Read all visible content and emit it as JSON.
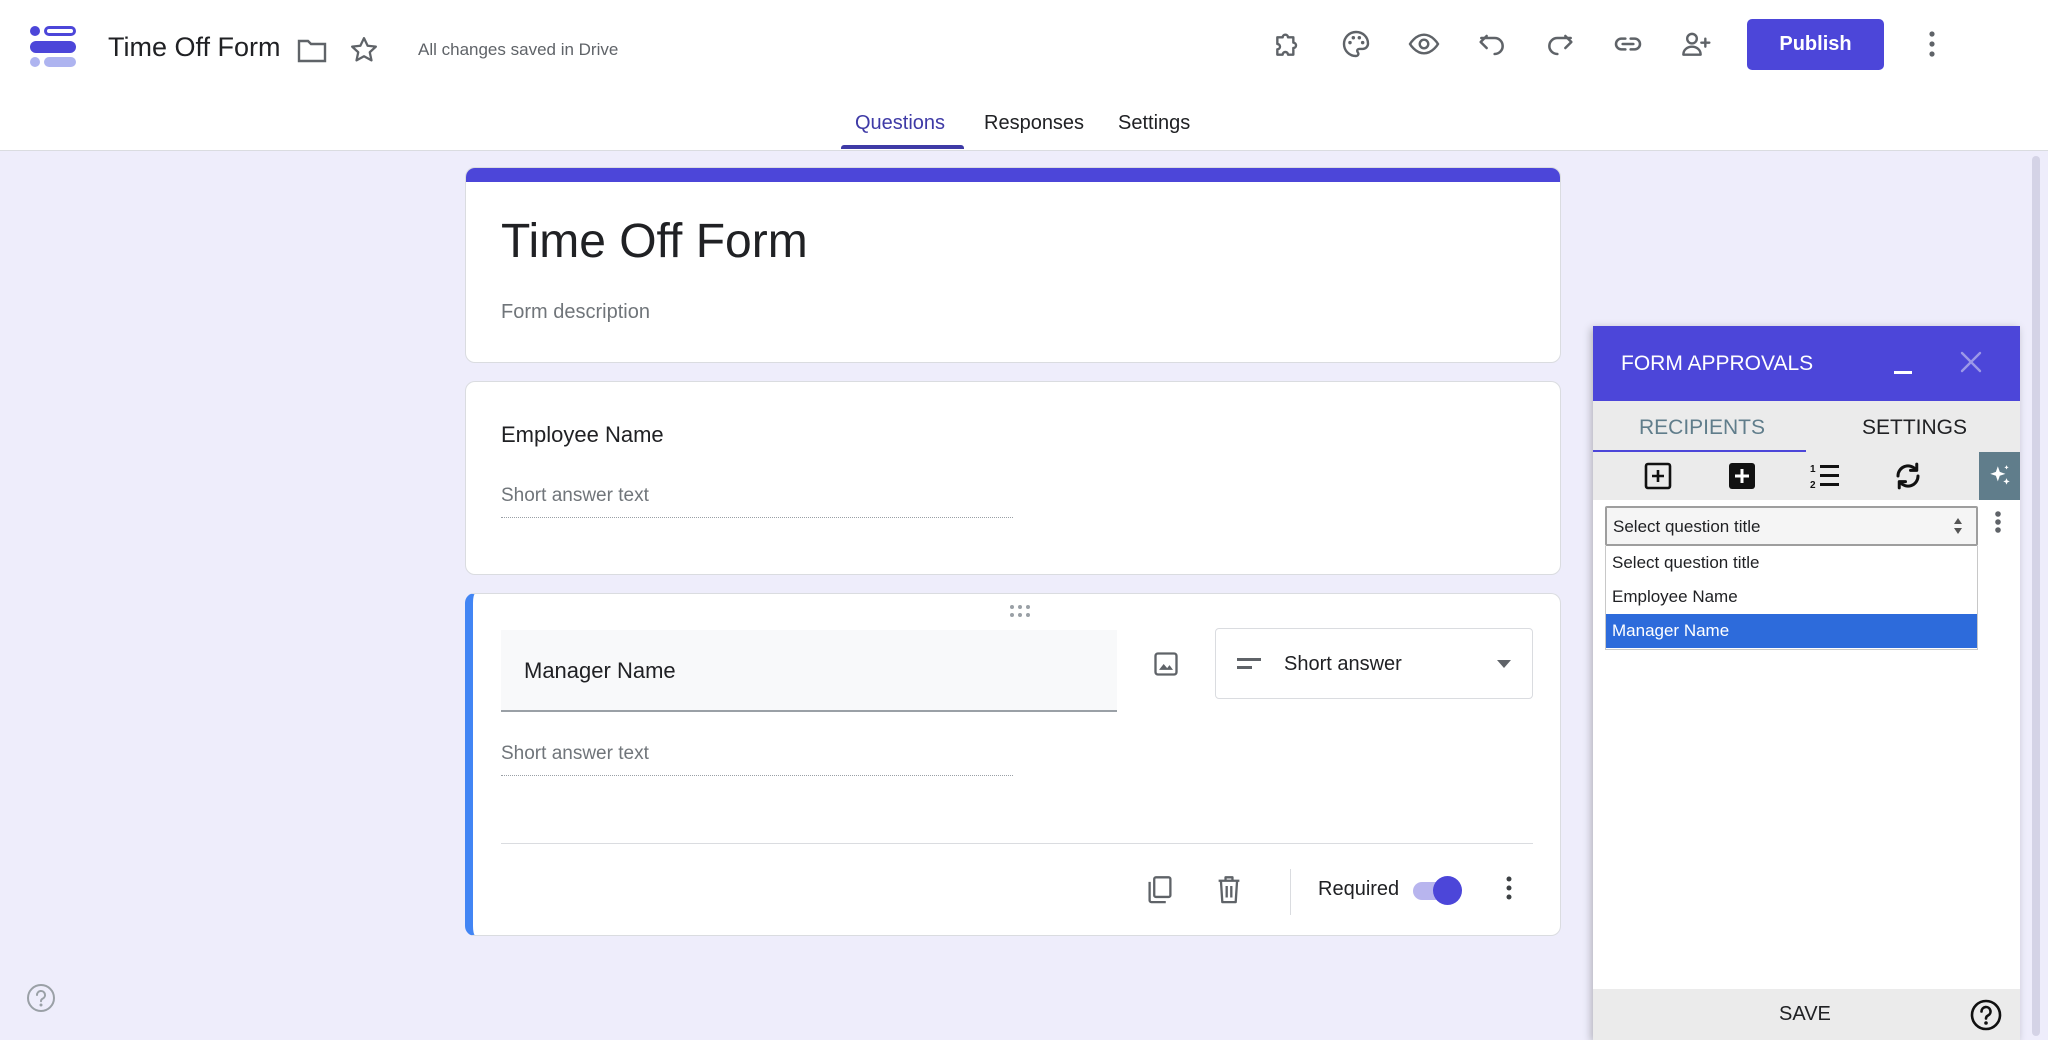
{
  "app": {
    "title": "Time Off Form",
    "saved_status": "All changes saved in Drive",
    "publish_label": "Publish",
    "accent": "#4c46d9"
  },
  "tabs": [
    {
      "label": "Questions",
      "active": true
    },
    {
      "label": "Responses",
      "active": false
    },
    {
      "label": "Settings",
      "active": false
    }
  ],
  "form": {
    "title": "Time Off Form",
    "description_placeholder": "Form description",
    "questions": [
      {
        "title": "Employee Name",
        "answer_hint": "Short answer text"
      },
      {
        "title": "Manager Name",
        "answer_hint": "Short answer text",
        "type": "Short answer",
        "required_label": "Required",
        "required": true
      }
    ]
  },
  "panel": {
    "title": "FORM APPROVALS",
    "tabs": [
      {
        "label": "RECIPIENTS",
        "active": true
      },
      {
        "label": "SETTINGS",
        "active": false
      }
    ],
    "select_value": "Select question title",
    "options": [
      "Select question title",
      "Employee Name",
      "Manager Name"
    ],
    "selected_option": "Manager Name",
    "save_label": "SAVE"
  }
}
